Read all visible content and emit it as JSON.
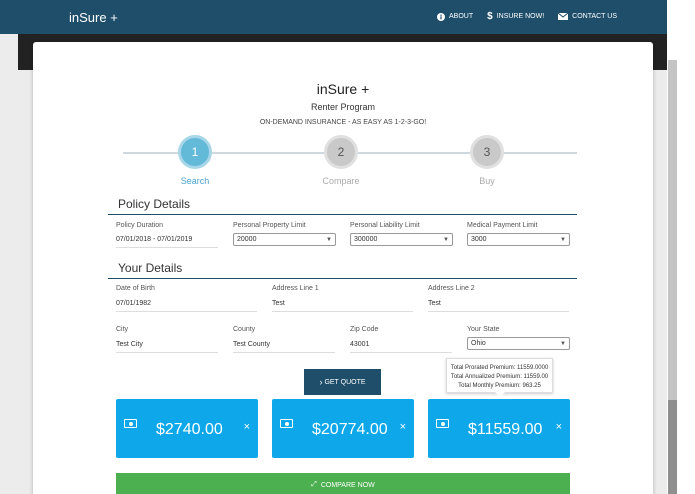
{
  "topbar": {
    "brand": "inSure +",
    "nav": [
      {
        "icon": "info-icon",
        "label": "ABOUT"
      },
      {
        "icon": "dollar-icon",
        "label": "INSURE NOW!"
      },
      {
        "icon": "envelope-icon",
        "label": "CONTACT US"
      }
    ]
  },
  "header": {
    "title": "inSure +",
    "subtitle": "Renter Program",
    "tagline": "ON-DEMAND INSURANCE - AS EASY AS 1-2-3-GO!"
  },
  "steps": [
    {
      "number": "1",
      "label": "Search",
      "state": "active"
    },
    {
      "number": "2",
      "label": "Compare",
      "state": "inactive"
    },
    {
      "number": "3",
      "label": "Buy",
      "state": "inactive"
    }
  ],
  "policy": {
    "heading": "Policy Details",
    "duration_label": "Policy Duration",
    "duration_value": "07/01/2018 - 07/01/2019",
    "property_label": "Personal Property Limit",
    "property_value": "20000",
    "liability_label": "Personal Liability Limit",
    "liability_value": "300000",
    "medical_label": "Medical Payment Limit",
    "medical_value": "3000"
  },
  "details": {
    "heading": "Your Details",
    "dob_label": "Date of Birth",
    "dob_value": "07/01/1982",
    "addr1_label": "Address Line 1",
    "addr1_value": "Test",
    "addr2_label": "Address Line 2",
    "addr2_value": "Test",
    "city_label": "City",
    "city_value": "Test City",
    "county_label": "County",
    "county_value": "Test County",
    "zip_label": "Zip Code",
    "zip_value": "43001",
    "state_label": "Your State",
    "state_value": "Ohio"
  },
  "tooltip": {
    "line1": "Total Prorated Premium: 11559.0000",
    "line2": "Total Annualized Premium: 11559.00",
    "line3": "Total Monthly Premium: 963.25"
  },
  "actions": {
    "get_quote": "GET QUOTE",
    "compare_now": "COMPARE NOW"
  },
  "quotes": [
    {
      "amount": "$2740.00",
      "close": "×"
    },
    {
      "amount": "$20774.00",
      "close": "×"
    },
    {
      "amount": "$11559.00",
      "close": "×"
    }
  ],
  "colors": {
    "nav": "#1f4e6b",
    "step_active": "#62b9d8",
    "quote": "#0ea8ea",
    "compare": "#4caf50"
  }
}
